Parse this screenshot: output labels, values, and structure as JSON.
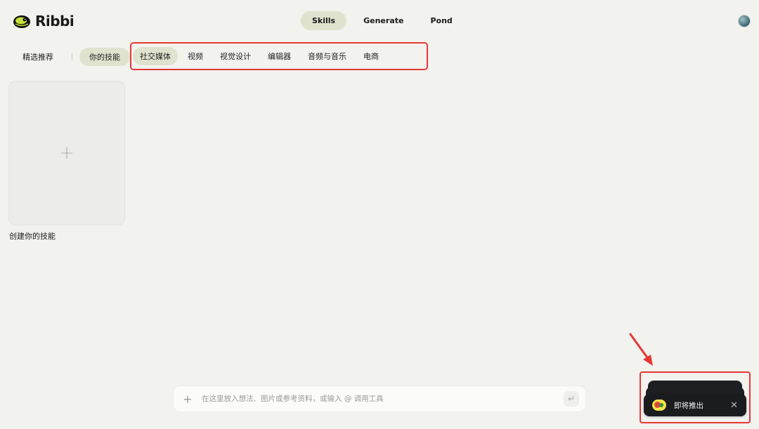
{
  "app": {
    "name": "Ribbi"
  },
  "topnav": {
    "tabs": [
      {
        "label": "Skills",
        "active": true
      },
      {
        "label": "Generate",
        "active": false
      },
      {
        "label": "Pond",
        "active": false
      }
    ]
  },
  "filters": {
    "primary": [
      {
        "label": "精选推荐",
        "active": false
      },
      {
        "label": "你的技能",
        "active": true
      }
    ],
    "categories": [
      "社交媒体",
      "视频",
      "视觉设计",
      "编辑器",
      "音频与音乐",
      "电商"
    ]
  },
  "create_card": {
    "label": "创建你的技能",
    "icon": "plus-icon"
  },
  "input": {
    "placeholder": "在这里放入想法、图片或参考资料，或输入 @ 调用工具",
    "value": ""
  },
  "toast": {
    "message": "即将推出"
  },
  "colors": {
    "accent_chip": "#dfe3cd",
    "highlight": "#e53935",
    "toast_bg": "#1b1c1f",
    "logo_green": "#c7e03a"
  }
}
